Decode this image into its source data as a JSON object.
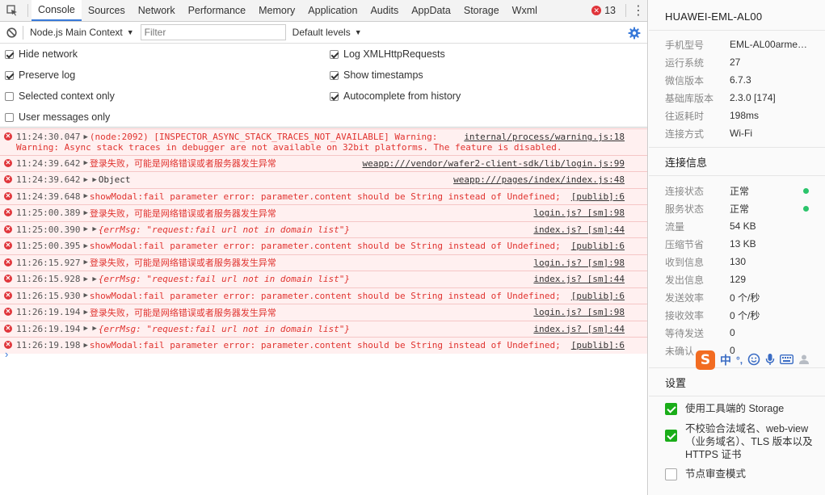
{
  "tabs": [
    {
      "label": "Console",
      "active": true
    },
    {
      "label": "Sources"
    },
    {
      "label": "Network"
    },
    {
      "label": "Performance"
    },
    {
      "label": "Memory"
    },
    {
      "label": "Application"
    },
    {
      "label": "Audits"
    },
    {
      "label": "AppData"
    },
    {
      "label": "Storage"
    },
    {
      "label": "Wxml"
    }
  ],
  "error_count": "13",
  "toolbar": {
    "context": "Node.js Main Context",
    "filter_placeholder": "Filter",
    "levels": "Default levels"
  },
  "settings": {
    "hide_network": {
      "label": "Hide network",
      "checked": true
    },
    "preserve_log": {
      "label": "Preserve log",
      "checked": true
    },
    "selected_context": {
      "label": "Selected context only",
      "checked": false
    },
    "user_messages": {
      "label": "User messages only",
      "checked": false
    },
    "log_xhr": {
      "label": "Log XMLHttpRequests",
      "checked": true
    },
    "show_timestamps": {
      "label": "Show timestamps",
      "checked": true
    },
    "autocomplete": {
      "label": "Autocomplete from history",
      "checked": true
    }
  },
  "logs": [
    {
      "ts": "11:24:30.047",
      "arrow": "▶",
      "msg": "(node:2092) [INSPECTOR_ASYNC_STACK_TRACES_NOT_AVAILABLE] Warning:",
      "src": "internal/process/warning.js:18",
      "cont": "Warning: Async stack traces in debugger are not available on 32bit platforms. The feature is disabled."
    },
    {
      "ts": "11:24:39.642",
      "arrow": "▶",
      "msg": "登录失败，可能是网络错误或者服务器发生异常",
      "src": "weapp:///vendor/wafer2-client-sdk/lib/login.js:99"
    },
    {
      "ts": "11:24:39.642",
      "arrow": "▶ ▶",
      "msg": "Object",
      "src": "weapp:///pages/index/index.js:48",
      "black": true
    },
    {
      "ts": "11:24:39.648",
      "arrow": "▶",
      "msg": "showModal:fail parameter error: parameter.content should be String instead of Undefined;",
      "src": "[publib]:6"
    },
    {
      "ts": "11:25:00.389",
      "arrow": "▶",
      "msg": "登录失败，可能是网络错误或者服务器发生异常",
      "src": "login.js? [sm]:98"
    },
    {
      "ts": "11:25:00.390",
      "arrow": "▶ ▶",
      "msg": "{errMsg: \"request:fail url not in domain list\"}",
      "src": "index.js? [sm]:44",
      "italic": true
    },
    {
      "ts": "11:25:00.395",
      "arrow": "▶",
      "msg": "showModal:fail parameter error: parameter.content should be String instead of Undefined;",
      "src": "[publib]:6"
    },
    {
      "ts": "11:26:15.927",
      "arrow": "▶",
      "msg": "登录失败，可能是网络错误或者服务器发生异常",
      "src": "login.js? [sm]:98"
    },
    {
      "ts": "11:26:15.928",
      "arrow": "▶ ▶",
      "msg": "{errMsg: \"request:fail url not in domain list\"}",
      "src": "index.js? [sm]:44",
      "italic": true
    },
    {
      "ts": "11:26:15.930",
      "arrow": "▶",
      "msg": "showModal:fail parameter error: parameter.content should be String instead of Undefined;",
      "src": "[publib]:6"
    },
    {
      "ts": "11:26:19.194",
      "arrow": "▶",
      "msg": "登录失败，可能是网络错误或者服务器发生异常",
      "src": "login.js? [sm]:98"
    },
    {
      "ts": "11:26:19.194",
      "arrow": "▶ ▶",
      "msg": "{errMsg: \"request:fail url not in domain list\"}",
      "src": "index.js? [sm]:44",
      "italic": true
    },
    {
      "ts": "11:26:19.198",
      "arrow": "▶",
      "msg": "showModal:fail parameter error: parameter.content should be String instead of Undefined;",
      "src": "[publib]:6"
    }
  ],
  "prompt": "›",
  "side": {
    "device": "HUAWEI-EML-AL00",
    "info": [
      {
        "k": "手机型号",
        "v": "EML-AL00armea…"
      },
      {
        "k": "运行系统",
        "v": "27"
      },
      {
        "k": "微信版本",
        "v": "6.7.3"
      },
      {
        "k": "基础库版本",
        "v": "2.3.0 [174]"
      },
      {
        "k": "往返耗时",
        "v": "198ms"
      },
      {
        "k": "连接方式",
        "v": "Wi-Fi"
      }
    ],
    "conn_title": "连接信息",
    "conn": [
      {
        "k": "连接状态",
        "v": "正常",
        "dot": true
      },
      {
        "k": "服务状态",
        "v": "正常",
        "dot": true
      },
      {
        "k": "流量",
        "v": "54 KB"
      },
      {
        "k": "压缩节省",
        "v": "13 KB"
      },
      {
        "k": "收到信息",
        "v": "130"
      },
      {
        "k": "发出信息",
        "v": "129"
      },
      {
        "k": "发送效率",
        "v": "0 个/秒"
      },
      {
        "k": "接收效率",
        "v": "0 个/秒"
      },
      {
        "k": "等待发送",
        "v": "0"
      },
      {
        "k": "未确认",
        "v": "0"
      }
    ],
    "settings_title": "设置",
    "opts": [
      {
        "label": "使用工具端的 Storage",
        "checked": true
      },
      {
        "label": "不校验合法域名、web-view（业务域名）、TLS 版本以及 HTTPS 证书",
        "checked": true
      },
      {
        "label": "节点审查模式",
        "checked": false
      }
    ],
    "ime": {
      "s": "S",
      "zh": "中",
      "punct": "°,"
    }
  }
}
